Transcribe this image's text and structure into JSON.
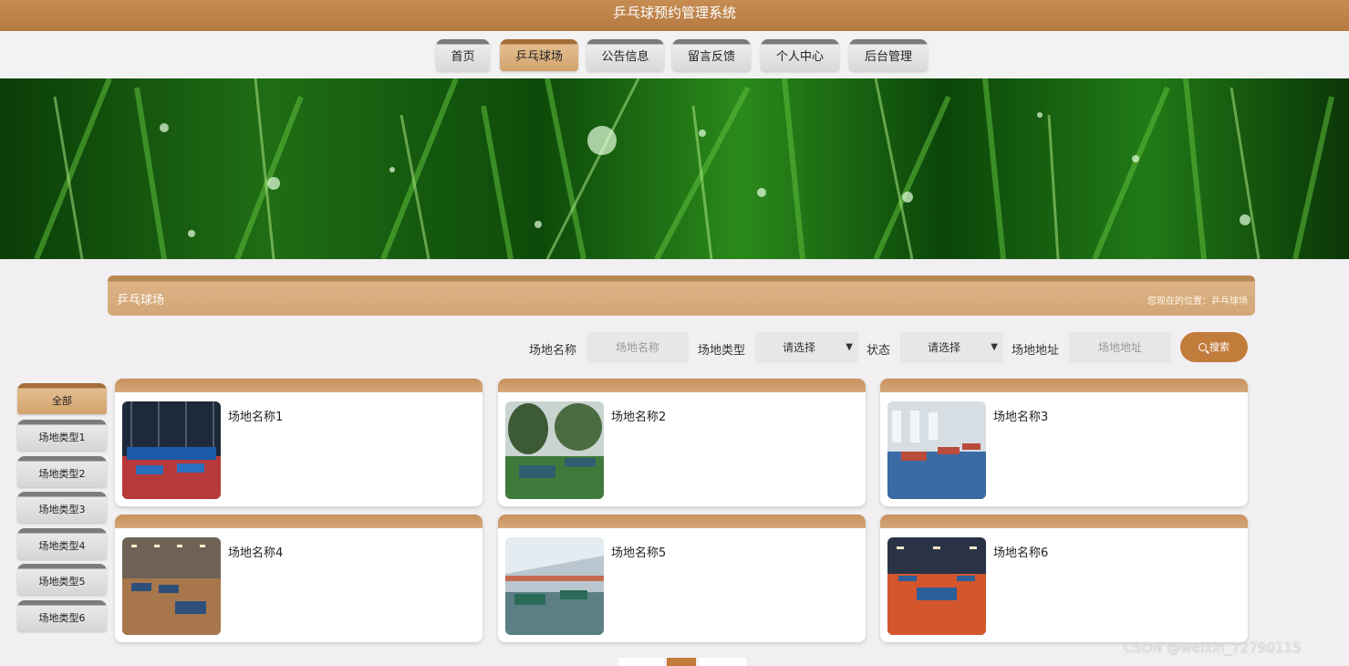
{
  "header": {
    "title": "乒乓球预约管理系统"
  },
  "nav": {
    "items": [
      {
        "label": "首页"
      },
      {
        "label": "乒乓球场"
      },
      {
        "label": "公告信息"
      },
      {
        "label": "留言反馈"
      },
      {
        "label": "个人中心"
      },
      {
        "label": "后台管理"
      }
    ],
    "active_index": 1
  },
  "section": {
    "title": "乒乓球场",
    "breadcrumb": "您现在的位置：乒乓球场"
  },
  "filters": {
    "name_label": "场地名称",
    "name_placeholder": "场地名称",
    "type_label": "场地类型",
    "type_value": "请选择",
    "status_label": "状态",
    "status_value": "请选择",
    "address_label": "场地地址",
    "address_placeholder": "场地地址",
    "search_label": "搜索"
  },
  "sidebar": {
    "items": [
      {
        "label": "全部"
      },
      {
        "label": "场地类型1"
      },
      {
        "label": "场地类型2"
      },
      {
        "label": "场地类型3"
      },
      {
        "label": "场地类型4"
      },
      {
        "label": "场地类型5"
      },
      {
        "label": "场地类型6"
      }
    ],
    "active_index": 0
  },
  "venues": [
    {
      "name": "场地名称1"
    },
    {
      "name": "场地名称2"
    },
    {
      "name": "场地名称3"
    },
    {
      "name": "场地名称4"
    },
    {
      "name": "场地名称5"
    },
    {
      "name": "场地名称6"
    }
  ],
  "watermark": "CSDN @weixin_72790115",
  "colors": {
    "accent": "#c17b3b",
    "header": "#b98853",
    "tab_active": "#d3a36e"
  }
}
